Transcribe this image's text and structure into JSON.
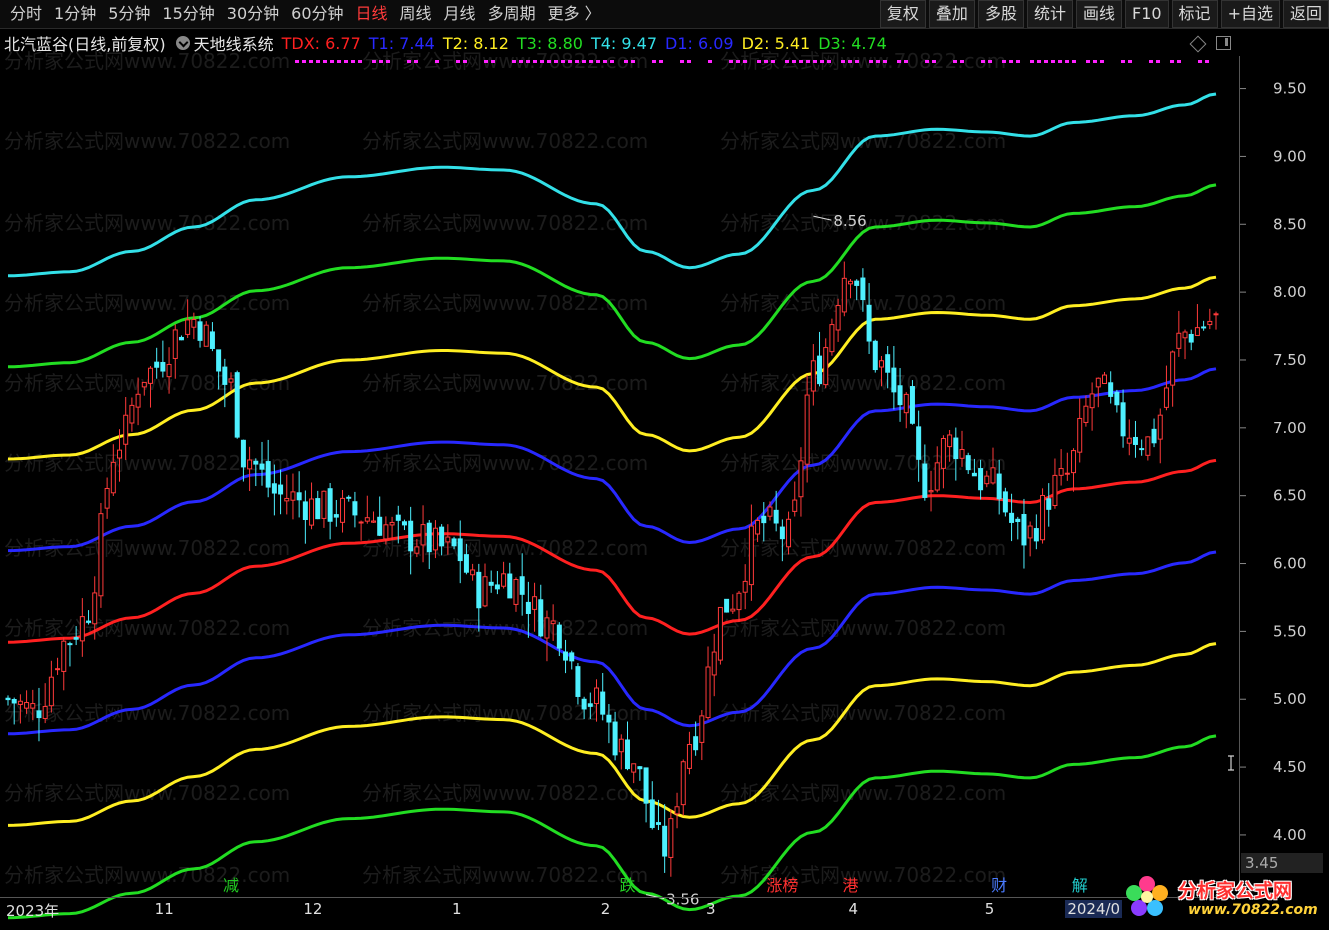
{
  "toolbar": {
    "tabs": [
      {
        "label": "分时",
        "active": false
      },
      {
        "label": "1分钟",
        "active": false
      },
      {
        "label": "5分钟",
        "active": false
      },
      {
        "label": "15分钟",
        "active": false
      },
      {
        "label": "30分钟",
        "active": false
      },
      {
        "label": "60分钟",
        "active": false
      },
      {
        "label": "日线",
        "active": true
      },
      {
        "label": "周线",
        "active": false
      },
      {
        "label": "月线",
        "active": false
      },
      {
        "label": "多周期",
        "active": false
      },
      {
        "label": "更多 〉",
        "active": false
      }
    ],
    "tools": [
      "复权",
      "叠加",
      "多股",
      "统计",
      "画线",
      "F10",
      "标记",
      "+自选",
      "返回"
    ]
  },
  "info": {
    "stock_title": "北汽蓝谷(日线,前复权)",
    "indicator_name": "天地线系统",
    "legend": [
      {
        "label": "TDX: 6.77",
        "color": "#ff2020"
      },
      {
        "label": "T1: 7.44",
        "color": "#2828ff"
      },
      {
        "label": "T2: 8.12",
        "color": "#ffee22"
      },
      {
        "label": "T3: 8.80",
        "color": "#22dd22"
      },
      {
        "label": "T4: 9.47",
        "color": "#33e0e8"
      },
      {
        "label": "D1: 6.09",
        "color": "#2828ff"
      },
      {
        "label": "D2: 5.41",
        "color": "#ffee22"
      },
      {
        "label": "D3: 4.74",
        "color": "#22dd22"
      }
    ]
  },
  "chart_data": {
    "type": "line",
    "title": "天地线系统",
    "ylim": [
      3.55,
      9.74
    ],
    "y_ticks": [
      4.0,
      4.5,
      5.0,
      5.5,
      6.0,
      6.5,
      7.0,
      7.5,
      8.0,
      8.5,
      9.0,
      9.5
    ],
    "y_tick_labels": [
      "4.00",
      "4.50",
      "5.00",
      "5.50",
      "6.00",
      "6.50",
      "7.00",
      "7.50",
      "8.00",
      "8.50",
      "9.00",
      "9.50"
    ],
    "x_labels": [
      "2023年",
      "11",
      "12",
      "1",
      "2",
      "3",
      "4",
      "5",
      "2024/0"
    ],
    "x_label_bar_index": [
      0,
      24,
      48,
      72,
      96,
      113,
      136,
      158,
      171
    ],
    "n_bars": 196,
    "band_anchor_bars": [
      0,
      10,
      20,
      30,
      40,
      55,
      70,
      80,
      95,
      103,
      110,
      118,
      130,
      140,
      150,
      158,
      165,
      172,
      182,
      190,
      195
    ],
    "center_line": {
      "name": "TDX",
      "color": "#ff2020",
      "values": [
        5.42,
        5.45,
        5.6,
        5.78,
        5.98,
        6.15,
        6.22,
        6.2,
        5.95,
        5.6,
        5.48,
        5.58,
        6.05,
        6.45,
        6.5,
        6.48,
        6.45,
        6.55,
        6.6,
        6.68,
        6.76
      ]
    },
    "band_offsets": [
      {
        "name": "T4",
        "offset": 2.7,
        "color": "#33e0e8"
      },
      {
        "name": "T3",
        "offset": 2.03,
        "color": "#22dd22"
      },
      {
        "name": "T2",
        "offset": 1.35,
        "color": "#ffee22"
      },
      {
        "name": "T1",
        "offset": 0.675,
        "color": "#2828ff"
      },
      {
        "name": "D1",
        "offset": -0.675,
        "color": "#2828ff"
      },
      {
        "name": "D2",
        "offset": -1.35,
        "color": "#ffee22"
      },
      {
        "name": "D3",
        "offset": -2.03,
        "color": "#22dd22"
      }
    ],
    "price_path": {
      "bars": [
        0,
        4,
        10,
        12,
        18,
        22,
        30,
        36,
        38,
        44,
        52,
        58,
        64,
        72,
        76,
        80,
        88,
        94,
        100,
        106,
        110,
        116,
        122,
        126,
        130,
        136,
        140,
        144,
        148,
        152,
        158,
        164,
        170,
        176,
        180,
        184,
        190,
        195
      ],
      "close": [
        5.0,
        4.92,
        5.45,
        5.58,
        6.9,
        7.4,
        7.8,
        7.3,
        6.8,
        6.5,
        6.4,
        6.35,
        6.2,
        6.1,
        5.8,
        5.9,
        5.55,
        5.0,
        4.6,
        3.9,
        4.7,
        5.7,
        6.3,
        6.2,
        7.4,
        8.2,
        7.5,
        7.2,
        6.6,
        6.9,
        6.6,
        6.2,
        6.6,
        7.3,
        7.0,
        6.9,
        7.7,
        7.8
      ]
    },
    "annotations": [
      {
        "text": "8.56",
        "bar": 130,
        "price": 8.56
      },
      {
        "text": "3.56",
        "bar": 103,
        "price": 3.56
      }
    ],
    "events": [
      {
        "text": "减",
        "bar": 36,
        "color": "#22cc22"
      },
      {
        "text": "跌",
        "bar": 100,
        "color": "#22cc22"
      },
      {
        "text": "涨榜",
        "bar": 125,
        "color": "#ff3030"
      },
      {
        "text": "港",
        "bar": 136,
        "color": "#ff3030"
      },
      {
        "text": "财",
        "bar": 160,
        "color": "#4a7bff"
      },
      {
        "text": "解",
        "bar": 173,
        "color": "#22cccc"
      }
    ],
    "grid": false,
    "watermark": "分析家公式网www.70822.com"
  },
  "readout": {
    "price": "3.45"
  },
  "logo": {
    "text": "分析家公式网",
    "url": "www.70822.com"
  }
}
